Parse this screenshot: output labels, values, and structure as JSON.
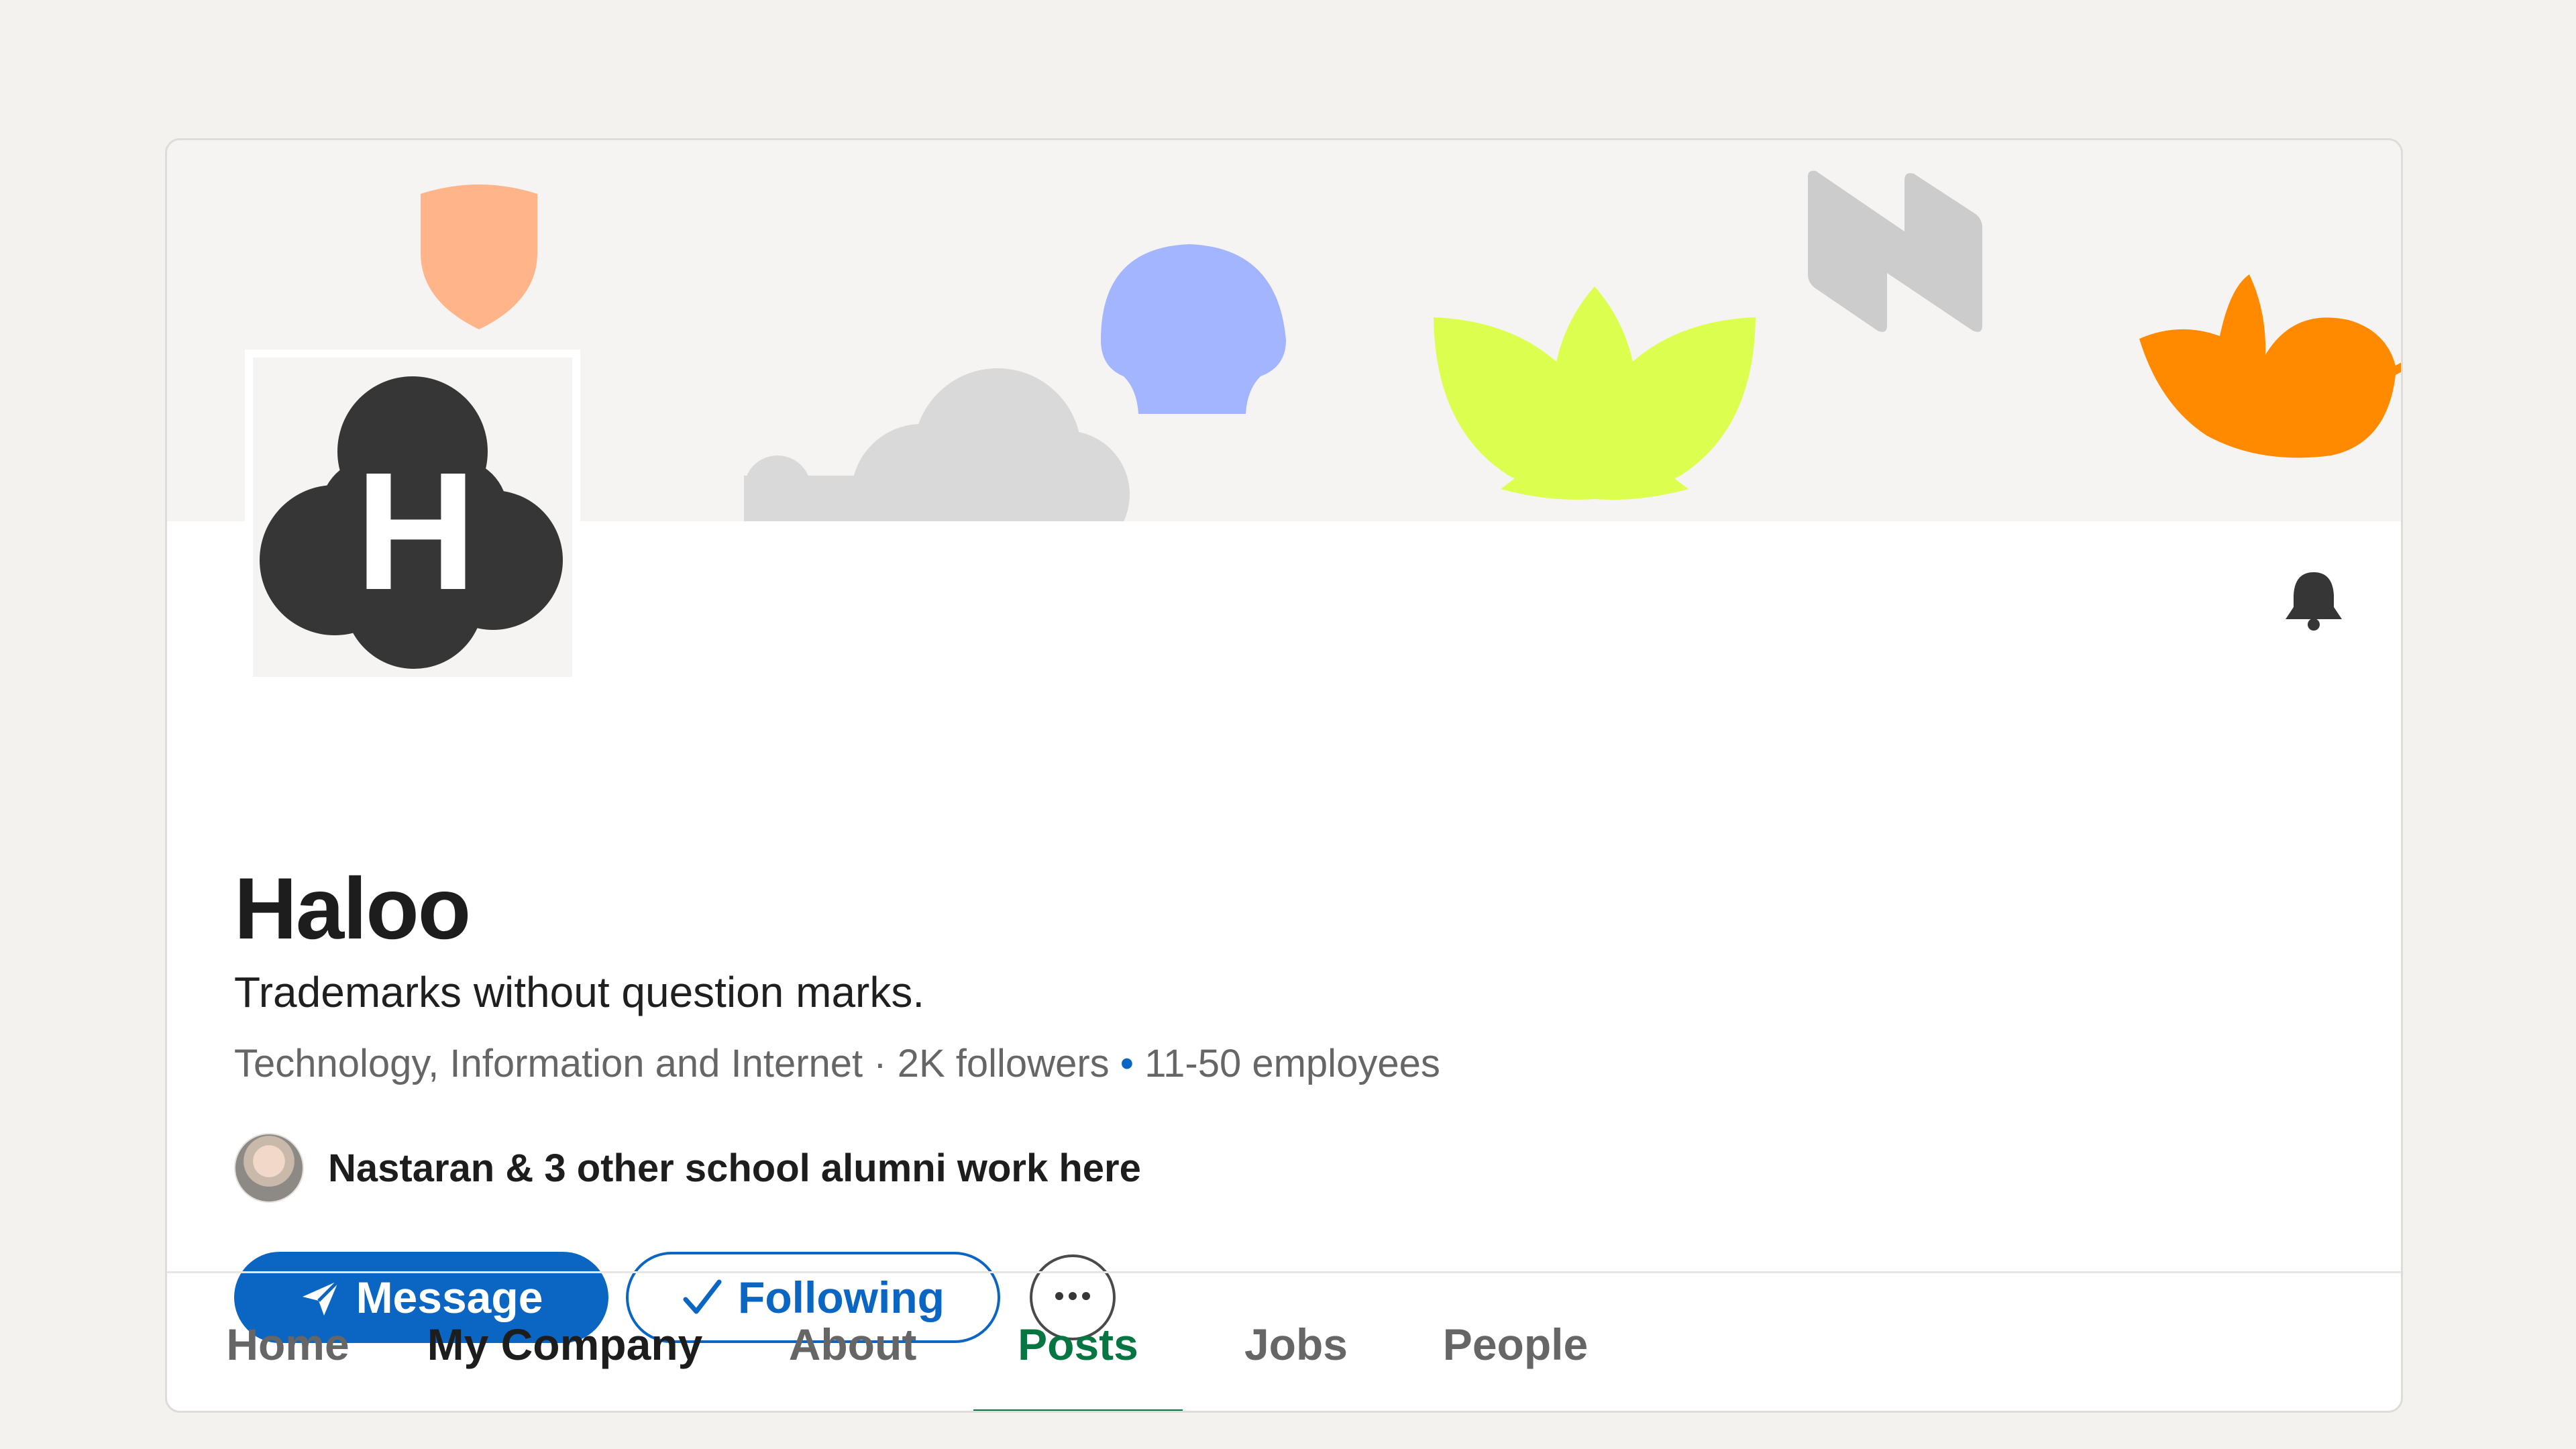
{
  "company": {
    "name": "Haloo",
    "logo_letter": "H",
    "tagline": "Trademarks without question marks.",
    "industry": "Technology, Information and Internet",
    "followers": "2K followers",
    "employees": "11-50 employees",
    "separator_gray": " · ",
    "separator_blue": " • "
  },
  "alumni": {
    "text": "Nastaran & 3 other school alumni work here",
    "avatar_icon": "person-photo"
  },
  "actions": {
    "message_label": "Message",
    "message_icon": "send-plane-icon",
    "following_label": "Following",
    "following_icon": "checkmark-icon",
    "more_icon": "ellipsis-icon"
  },
  "notifications": {
    "icon": "bell-icon"
  },
  "tabs": [
    {
      "label": "Home",
      "state": "normal"
    },
    {
      "label": "My Company",
      "state": "emphasis"
    },
    {
      "label": "About",
      "state": "normal"
    },
    {
      "label": "Posts",
      "state": "active"
    },
    {
      "label": "Jobs",
      "state": "normal"
    },
    {
      "label": "People",
      "state": "normal"
    }
  ],
  "colors": {
    "primary_blue": "#0a66c2",
    "active_green": "#057642",
    "banner_bg": "#f5f4f2",
    "shape_peach": "#ffb48a",
    "shape_blue": "#a3b5ff",
    "shape_lime": "#dcff4f",
    "shape_gray": "#cccccc",
    "shape_orange": "#ff8a00",
    "logo_dark": "#363636"
  }
}
